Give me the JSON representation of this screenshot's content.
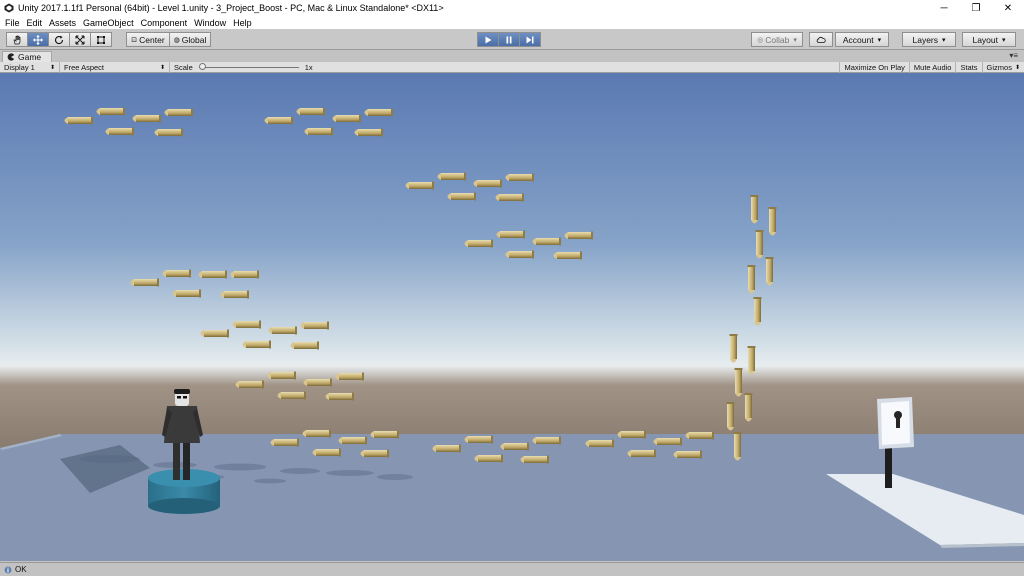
{
  "window": {
    "title": "Unity 2017.1.1f1 Personal (64bit) - Level 1.unity - 3_Project_Boost - PC, Mac & Linux Standalone* <DX11>",
    "minimize": "─",
    "maximize": "❐",
    "close": "✕"
  },
  "menu": [
    "File",
    "Edit",
    "Assets",
    "GameObject",
    "Component",
    "Window",
    "Help"
  ],
  "toolbar": {
    "tools": [
      "hand-tool",
      "move-tool",
      "rotate-tool",
      "scale-tool",
      "rect-tool"
    ],
    "pivot_label": "Center",
    "space_label": "Global",
    "collab_label": "Collab",
    "account_label": "Account",
    "layers_label": "Layers",
    "layout_label": "Layout"
  },
  "game_tab": {
    "label": "Game",
    "menu_glyph": "▾≡"
  },
  "game_bar": {
    "display": "Display 1",
    "aspect": "Free Aspect",
    "scale_label": "Scale",
    "scale_value": "1x",
    "maximize_on_play": "Maximize On Play",
    "mute_audio": "Mute Audio",
    "stats": "Stats",
    "gizmos": "Gizmos"
  },
  "status": {
    "text": "OK"
  },
  "colors": {
    "sky_top": "#5a79b2",
    "horizon": "#e8edef",
    "ground": "#6e6256",
    "platform": "#8697b4",
    "bullet": "#c8b47a",
    "pad": "#2f7f9b",
    "play_active": "#4a6ea6"
  }
}
